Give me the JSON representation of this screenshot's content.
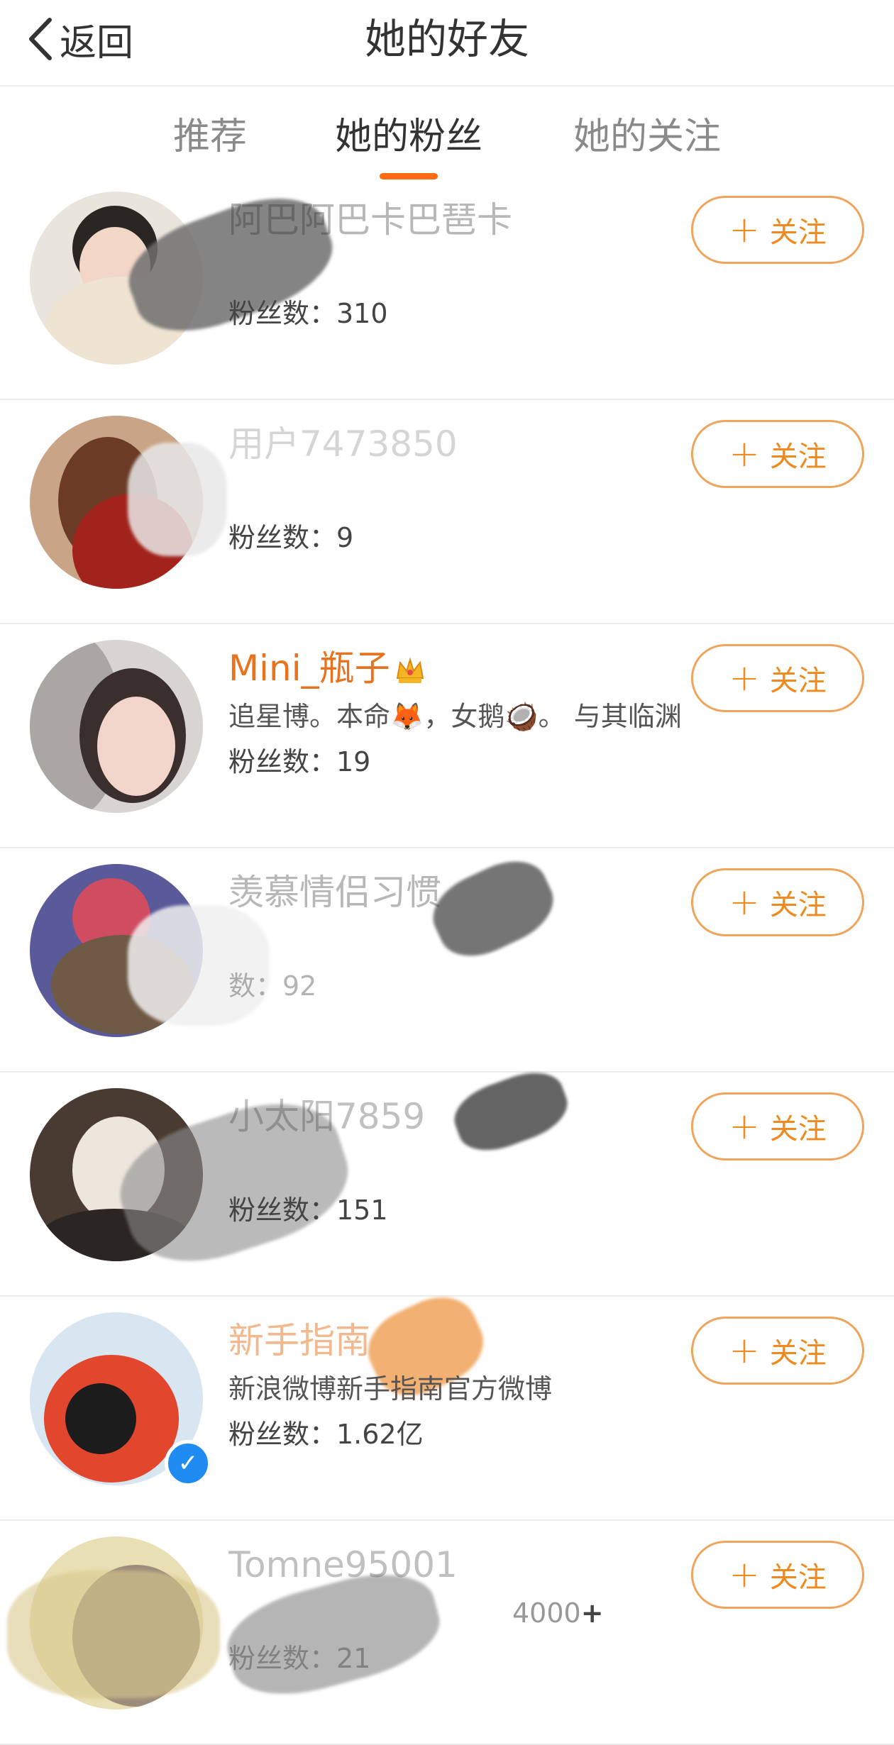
{
  "header": {
    "back_label": "返回",
    "title": "她的好友"
  },
  "tabs": [
    {
      "label": "推荐",
      "active": false
    },
    {
      "label": "她的粉丝",
      "active": true
    },
    {
      "label": "她的关注",
      "active": false
    }
  ],
  "follow_label": "关注",
  "colors": {
    "accent": "#ff6a13",
    "follow_text": "#ef8a1f",
    "follow_border": "#f0a35a",
    "orange_name": "#e8731e",
    "verified": "#1e8cf0"
  },
  "users": [
    {
      "name": "阿巴阿巴卡巴琶卡",
      "bio": "",
      "fans": "粉丝数：310",
      "verified": false
    },
    {
      "name": "用户7473850",
      "bio": "",
      "fans": "粉丝数：9",
      "verified": false
    },
    {
      "name": "Mini_瓶子",
      "bio": "追星博。本命🦊，女鹅🥥。 与其临渊羡鱼，…",
      "fans": "粉丝数：19",
      "verified": false
    },
    {
      "name": "羡慕情侣习惯",
      "bio": "",
      "fans": "数：92",
      "verified": false
    },
    {
      "name": "小太阳7859",
      "bio": "",
      "fans": "粉丝数：151",
      "verified": false
    },
    {
      "name": "新手指南",
      "bio": "新浪微博新手指南官方微博",
      "fans": "粉丝数：1.62亿",
      "verified": true
    },
    {
      "name": "Tomne95001",
      "bio": "4000",
      "fans": "粉丝数：21",
      "verified": false
    }
  ]
}
